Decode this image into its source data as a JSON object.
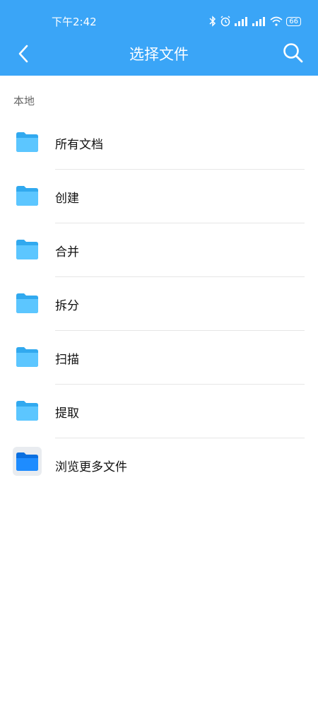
{
  "status_bar": {
    "time": "下午2:42",
    "battery": "66"
  },
  "header": {
    "title": "选择文件",
    "back_icon": "chevron-left-icon",
    "search_icon": "search-icon",
    "color": "#3aa5f7"
  },
  "section": {
    "label": "本地"
  },
  "items": [
    {
      "label": "所有文档",
      "icon": "folder-icon"
    },
    {
      "label": "创建",
      "icon": "folder-icon"
    },
    {
      "label": "合并",
      "icon": "folder-icon"
    },
    {
      "label": "拆分",
      "icon": "folder-icon"
    },
    {
      "label": "扫描",
      "icon": "folder-icon"
    },
    {
      "label": "提取",
      "icon": "folder-icon"
    },
    {
      "label": "浏览更多文件",
      "icon": "files-app-icon"
    }
  ]
}
